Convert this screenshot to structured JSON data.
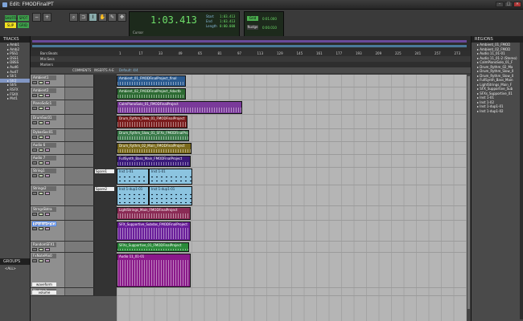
{
  "window": {
    "title": "Edit: FMODFinalPT"
  },
  "toolbar": {
    "modes": [
      {
        "label": "SHUFFLE",
        "color": "#3fa34d"
      },
      {
        "label": "SLIP",
        "color": "#f0e020"
      },
      {
        "label": "SPOT",
        "color": "#3fa34d"
      },
      {
        "label": "GRID",
        "color": "#3fa34d"
      }
    ],
    "counter": {
      "main": "1:03.413",
      "start_label": "Start",
      "start": "1:03.413",
      "end_label": "End",
      "end": "1:03.413",
      "length_label": "Length",
      "length": "0:00.000",
      "cursor_label": "Cursor"
    },
    "grid_label": "Grid",
    "grid_value": "0:01.000",
    "nudge_label": "Nudge",
    "nudge_value": "0:00.010"
  },
  "tracks_panel": {
    "header": "TRACKS",
    "items": [
      "Amb1",
      "Amb2",
      "PSS1",
      "DSS1",
      "DBSS",
      "Aud6",
      "Aud7",
      "Str1",
      "Str2",
      "StrS",
      "RSFX",
      "FSXX",
      "Mst1"
    ],
    "selected_index": 8
  },
  "groups_panel": {
    "header": "GROUPS",
    "items": [
      "<ALL>"
    ]
  },
  "rulers": {
    "labels": [
      "Bars:Beats",
      "Min:Secs",
      "Markers"
    ],
    "ticks": [
      "1",
      "17",
      "33",
      "49",
      "65",
      "81",
      "97",
      "113",
      "129",
      "145",
      "161",
      "177",
      "193",
      "209",
      "225",
      "241",
      "257",
      "273"
    ],
    "default_label": "Default: 4/4"
  },
  "columns": {
    "comments": "COMMENTS",
    "inserts": "INSERTS A-E"
  },
  "tracks": [
    {
      "name": "Ambient1",
      "height": 16
    },
    {
      "name": "Ambient2",
      "height": 16
    },
    {
      "name": "PianoSoSc1",
      "height": 18
    },
    {
      "name": "DrumSoc01",
      "height": 18
    },
    {
      "name": "DybasSoc01",
      "height": 16
    },
    {
      "name": "Audio 6",
      "height": 16
    },
    {
      "name": "Audio 7",
      "height": 16
    },
    {
      "name": "String1",
      "height": 22,
      "insert": "Spare1"
    },
    {
      "name": "Strings2",
      "height": 26,
      "insert": "Spare2"
    },
    {
      "name": "StrngsSbtra",
      "height": 18
    },
    {
      "name": "RandomSFX3",
      "height": 26,
      "selected": true
    },
    {
      "name": "RandomSFX1",
      "height": 14
    },
    {
      "name": "FxNoteMix0",
      "height": 44,
      "sub": "waveform"
    },
    {
      "name": "Master 1",
      "height": 10,
      "sub": "volume"
    }
  ],
  "clips": [
    {
      "track": 0,
      "start": 0,
      "width": 86,
      "name": "Ambient_01_FMODFinalProject_final",
      "color": "#2a5a8f"
    },
    {
      "track": 1,
      "start": 0,
      "width": 86,
      "name": "Ambient_02_FMODFinalProject_Adactb",
      "color": "#2d6b33"
    },
    {
      "track": 2,
      "start": 0,
      "width": 156,
      "name": "CalmPianoSolo_01_FMODFinalProject",
      "color": "#7a3a9a"
    },
    {
      "track": 3,
      "start": 0,
      "width": 88,
      "name": "Drum_Rythm_Slow_01_FMODFinalProject",
      "color": "#7a1c1c"
    },
    {
      "track": 4,
      "start": 0,
      "width": 90,
      "name": "Drum_Rythm_Slow_01_SFXs_FMODFinalProject",
      "color": "#3a7a4a"
    },
    {
      "track": 5,
      "start": 0,
      "width": 93,
      "name": "Drum_Rythm_02_Main_FMODFinalProject",
      "color": "#7a6a1c"
    },
    {
      "track": 6,
      "start": 0,
      "width": 92,
      "name": "FullSynth_Bass_Main_FMODFinalProject",
      "color": "#3a1a7a"
    },
    {
      "track": 7,
      "start": 0,
      "width": 40,
      "name": "Inst 1-01",
      "color": "#8cc4e0",
      "midi": true
    },
    {
      "track": 7,
      "start": 40,
      "width": 54,
      "name": "Inst 1-01",
      "color": "#8cc4e0",
      "midi": true
    },
    {
      "track": 8,
      "start": 0,
      "width": 40,
      "name": "Inst 1-dup1-01",
      "color": "#8cc4e0",
      "midi": true
    },
    {
      "track": 8,
      "start": 40,
      "width": 54,
      "name": "Inst 1-dup1-01",
      "color": "#8cc4e0",
      "midi": true
    },
    {
      "track": 9,
      "start": 0,
      "width": 92,
      "name": "LightStrings_Main_FMODFinalProject",
      "color": "#8a2b55"
    },
    {
      "track": 10,
      "start": 0,
      "width": 92,
      "name": "SFX_Supportive_Subdas_FMODFinalProject",
      "color": "#6a1e9a"
    },
    {
      "track": 11,
      "start": 0,
      "width": 90,
      "name": "SFXs_Supportive_01_FMODFinalProject",
      "color": "#2a8a3a"
    },
    {
      "track": 12,
      "start": 0,
      "width": 92,
      "name": "Audio 11_01-01",
      "color": "#8a1a8a"
    }
  ],
  "regions_panel": {
    "header": "REGIONS",
    "items": [
      "Ambient_01_FMOD",
      "Ambient_02_FMOD",
      "Audio 11_01-01",
      "Audio 11_01-2 (Stereo)",
      "CalmPianoSolo_01_F",
      "Drum_Rythm_02_Ma",
      "Drum_Rythm_Slow_0",
      "Drum_Rythm_Slow_0",
      "FullSynth_Bass_Main",
      "LightStrings_Main_F",
      "SFX_Supportive_Sub",
      "SFXs_Supportive_01",
      "Inst 1-01",
      "Inst 1-02",
      "Inst 1-dup1-01",
      "Inst 1-dup1-02"
    ]
  }
}
